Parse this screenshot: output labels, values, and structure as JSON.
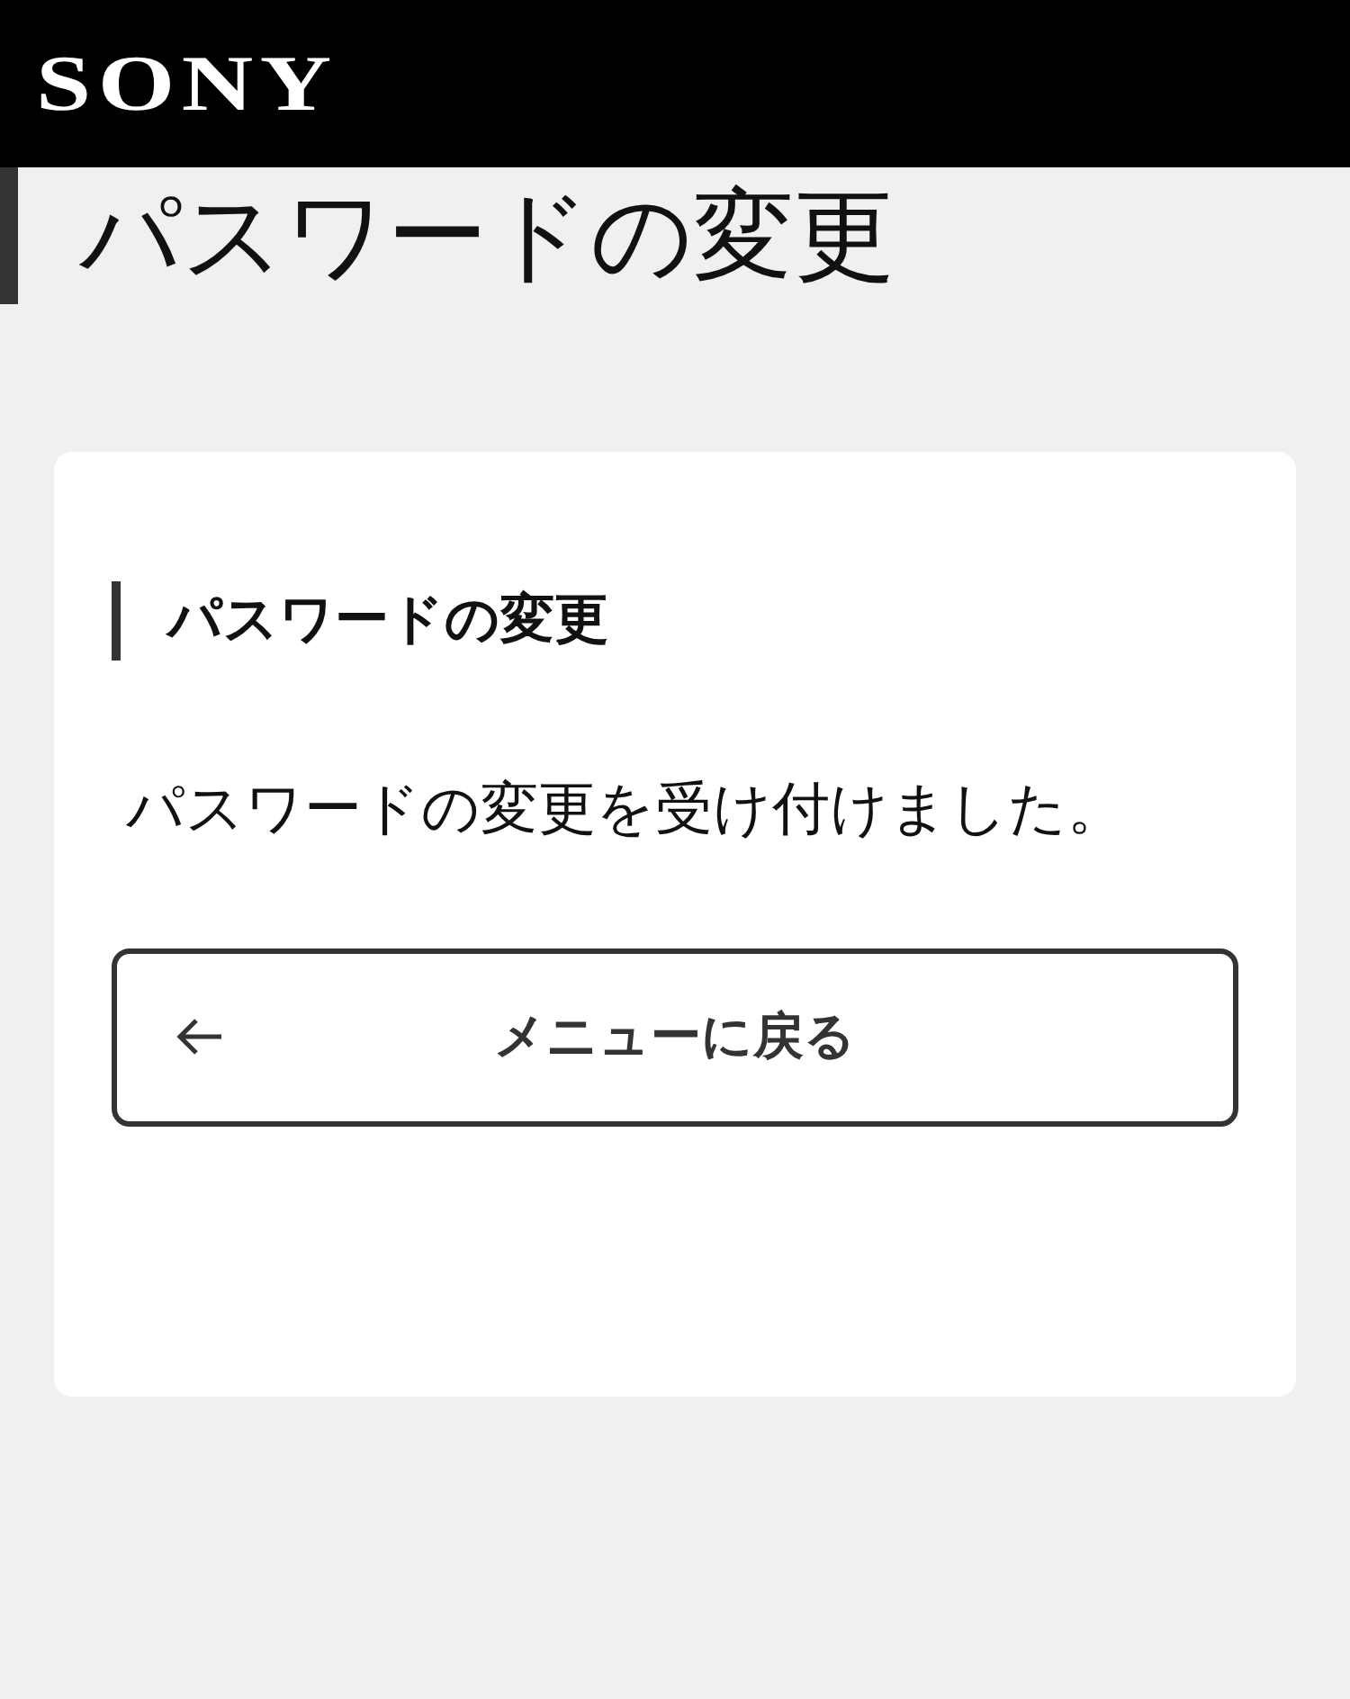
{
  "header": {
    "logo": "SONY"
  },
  "page_title": "パスワードの変更",
  "card": {
    "heading": "パスワードの変更",
    "message": "パスワードの変更を受け付けました。",
    "button": {
      "label": "メニューに戻る"
    }
  }
}
